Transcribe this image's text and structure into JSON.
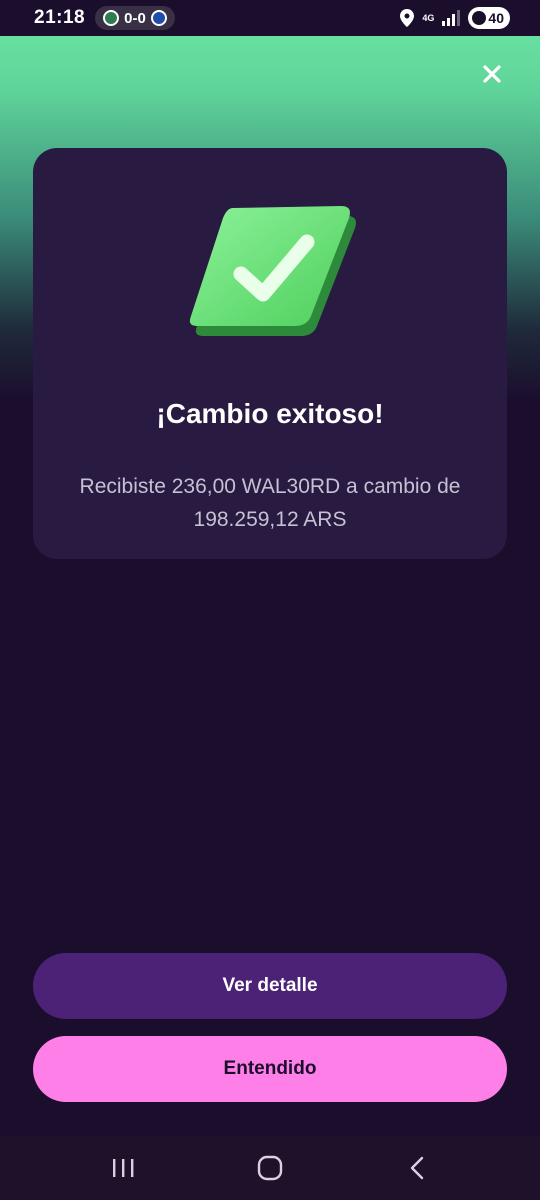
{
  "status_bar": {
    "time": "21:18",
    "score": "0-0",
    "network": "4G",
    "battery": "40"
  },
  "icons": {
    "close": "close-icon",
    "check": "check-icon",
    "recent_apps": "recent-apps-icon",
    "home": "home-icon",
    "back": "back-icon"
  },
  "card": {
    "title": "¡Cambio exitoso!",
    "message": "Recibiste 236,00 WAL30RD a cambio de 198.259,12 ARS"
  },
  "buttons": {
    "details_label": "Ver detalle",
    "ok_label": "Entendido"
  },
  "colors": {
    "background": "#1b0e2d",
    "card": "#281a41",
    "accent_green": "#6ee8a4",
    "secondary_button": "#4c2277",
    "primary_button": "#ff7fe8"
  }
}
